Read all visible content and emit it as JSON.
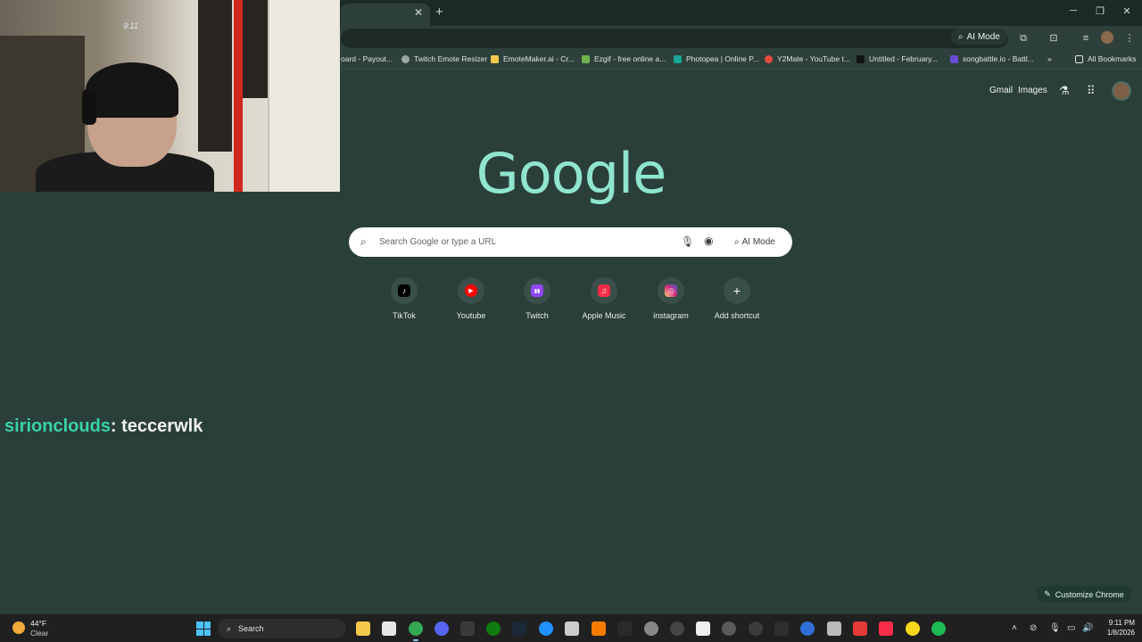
{
  "browser": {
    "toolbar": {
      "ai_mode_label": "AI Mode"
    },
    "bookmarks": [
      {
        "label": "oard - Payout...",
        "icon": "dashboard-icon",
        "color": "#2e403b"
      },
      {
        "label": "Twitch Emote Resizer",
        "icon": "globe-icon",
        "color": "#9aa7a3"
      },
      {
        "label": "EmoteMaker.ai - Cr...",
        "icon": "emotemaker-icon",
        "color": "#f2c94c"
      },
      {
        "label": "Ezgif - free online a...",
        "icon": "ezgif-icon",
        "color": "#6fb34b"
      },
      {
        "label": "Photopea | Online P...",
        "icon": "photopea-icon",
        "color": "#18a497"
      },
      {
        "label": "Y2Mate - YouTube t...",
        "icon": "y2mate-icon",
        "color": "#e94b3c"
      },
      {
        "label": "Untitled - February...",
        "icon": "untitled-icon",
        "color": "#111111"
      },
      {
        "label": "songbattle.io - Battl...",
        "icon": "songbattle-icon",
        "color": "#6b4cd6"
      }
    ],
    "bookmarks_overflow": "»",
    "all_bookmarks_label": "All Bookmarks"
  },
  "webcam": {
    "timestamp": "9:11"
  },
  "ntp": {
    "header_links": {
      "gmail": "Gmail",
      "images": "Images"
    },
    "logo_text": "Google",
    "search": {
      "placeholder": "Search Google or type a URL",
      "ai_mode_label": "AI Mode"
    },
    "shortcuts": [
      {
        "label": "TikTok",
        "icon": "tiktok-icon",
        "color": "#000000",
        "glyph": "♪"
      },
      {
        "label": "Youtube",
        "icon": "youtube-icon",
        "color": "#ff0000",
        "glyph": "▶"
      },
      {
        "label": "Twitch",
        "icon": "twitch-icon",
        "color": "#9146ff",
        "glyph": "▮▮"
      },
      {
        "label": "Apple Music",
        "icon": "apple-music-icon",
        "color": "#fa2d48",
        "glyph": "♫"
      },
      {
        "label": "instagram",
        "icon": "instagram-icon",
        "color": "#d62976",
        "glyph": "◎"
      },
      {
        "label": "Add shortcut",
        "icon": "plus-icon",
        "color": "#3a4f49",
        "glyph": "+"
      }
    ],
    "customize_label": "Customize Chrome"
  },
  "chat": {
    "username": "sirionclouds",
    "separator": ":",
    "message": "teccerwlk",
    "username_color": "#37d3a7"
  },
  "taskbar": {
    "weather_temp": "44°F",
    "weather_desc": "Clear",
    "search_label": "Search",
    "clock_time": "9:11 PM",
    "clock_date": "1/8/2026"
  },
  "colors": {
    "background": "#2b3f3a",
    "logo": "#8fe6cc",
    "accent": "#37d3a7"
  }
}
